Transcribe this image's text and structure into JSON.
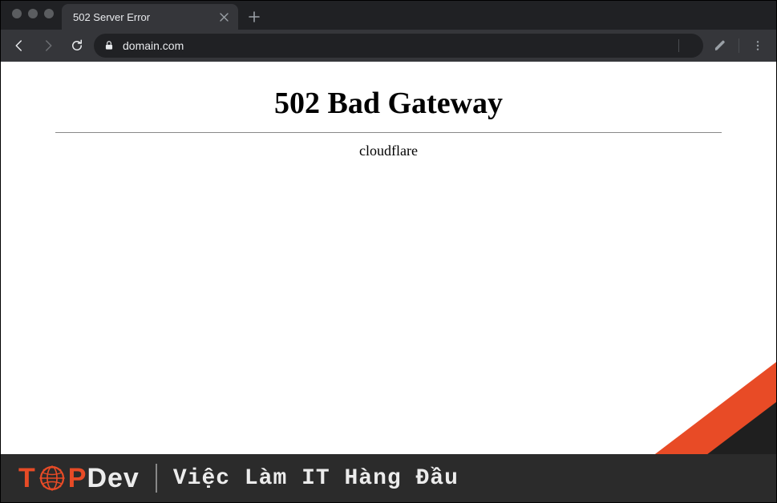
{
  "browser": {
    "tab_title": "502 Server Error",
    "url": "domain.com"
  },
  "page": {
    "heading": "502 Bad Gateway",
    "provider": "cloudflare"
  },
  "banner": {
    "logo_t": "T",
    "logo_p": "P",
    "logo_dev": "Dev",
    "tagline": "Việc Làm IT Hàng Đầu"
  },
  "colors": {
    "accent": "#e84b26",
    "chrome_bg": "#202124",
    "toolbar_bg": "#35363a",
    "banner_bg": "#2b2b2b"
  }
}
